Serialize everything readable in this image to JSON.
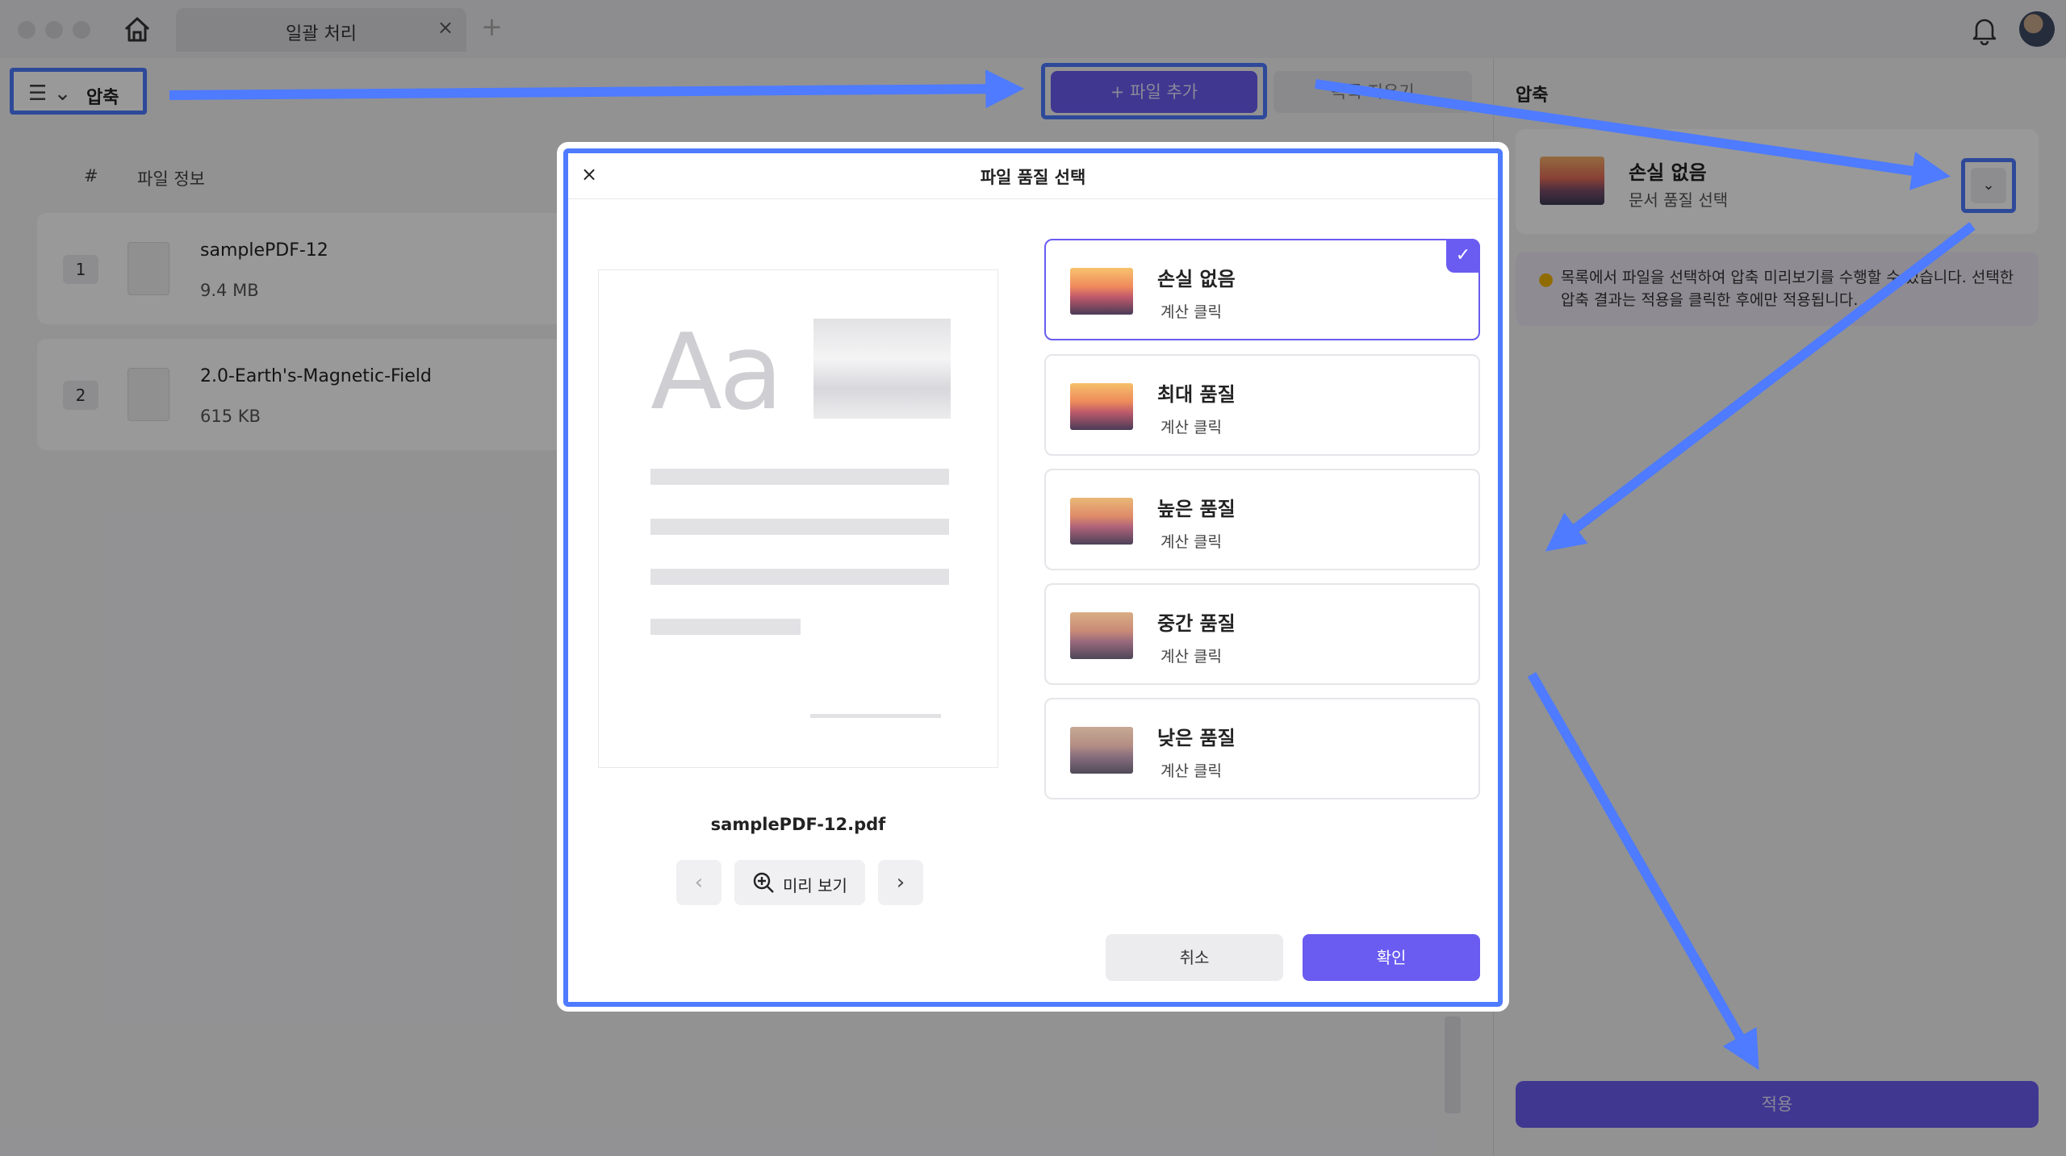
{
  "tab": {
    "title": "일괄 처리",
    "close": "×",
    "add": "+"
  },
  "menu": {
    "icon": "☰ ⌄",
    "label": "압축"
  },
  "toolbar": {
    "add_file": "+ 파일 추가",
    "clear": "목록 지우기"
  },
  "list": {
    "headers": {
      "index": "#",
      "info": "파일 정보"
    },
    "files": [
      {
        "num": "1",
        "name": "samplePDF-12",
        "size": "9.4 MB"
      },
      {
        "num": "2",
        "name": "2.0-Earth's-Magnetic-Field",
        "size": "615 KB"
      }
    ]
  },
  "right_panel": {
    "title": "압축",
    "quality_title": "손실 없음",
    "quality_sub": "문서 품질 선택",
    "dropdown_icon": "⌄",
    "notice": "목록에서 파일을 선택하여 압축 미리보기를 수행할 수 있습니다. 선택한 압축 결과는 적용을 클릭한 후에만 적용됩니다.",
    "apply": "적용"
  },
  "modal": {
    "close": "×",
    "title": "파일 품질 선택",
    "preview_text": "Aa",
    "file_name": "samplePDF-12.pdf",
    "nav_prev": "‹",
    "preview_label": "미리 보기",
    "nav_next": "›",
    "options": [
      {
        "title": "손실 없음",
        "sub": "계산 클릭",
        "selected": true
      },
      {
        "title": "최대 품질",
        "sub": "계산 클릭",
        "selected": false
      },
      {
        "title": "높은 품질",
        "sub": "계산 클릭",
        "selected": false
      },
      {
        "title": "중간 품질",
        "sub": "계산 클릭",
        "selected": false
      },
      {
        "title": "낮은 품질",
        "sub": "계산 클릭",
        "selected": false
      }
    ],
    "check": "✓",
    "cancel": "취소",
    "confirm": "확인"
  },
  "colors": {
    "accent": "#6a5cf0",
    "highlight": "#4e7bff"
  },
  "icons": [
    "home-icon",
    "bell-icon",
    "avatar",
    "menu-icon",
    "chevron-down-icon",
    "bulb-icon",
    "close-icon",
    "zoom-in-icon",
    "check-icon",
    "chevron-left-icon",
    "chevron-right-icon"
  ]
}
